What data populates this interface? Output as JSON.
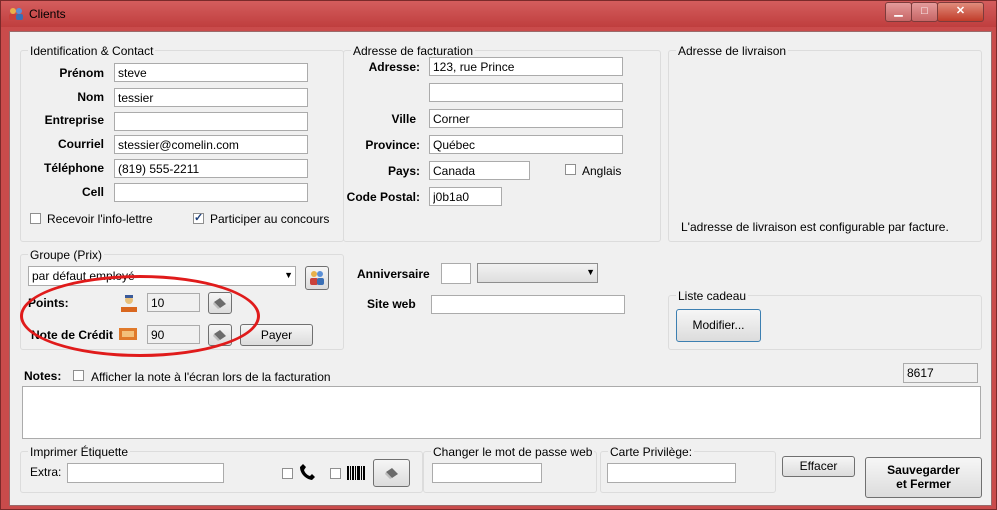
{
  "window": {
    "title": "Clients"
  },
  "identification": {
    "legend": "Identification & Contact",
    "labels": {
      "prenom": "Prénom",
      "nom": "Nom",
      "entreprise": "Entreprise",
      "courriel": "Courriel",
      "telephone": "Téléphone",
      "cell": "Cell"
    },
    "values": {
      "prenom": "steve",
      "nom": "tessier",
      "entreprise": "",
      "courriel": "stessier@comelin.com",
      "telephone": "(819) 555-2211",
      "cell": ""
    },
    "checkboxes": {
      "infolettre": "Recevoir l'info-lettre",
      "concours": "Participer au concours"
    }
  },
  "facturation": {
    "legend": "Adresse de facturation",
    "labels": {
      "adresse": "Adresse:",
      "ville": "Ville",
      "province": "Province:",
      "pays": "Pays:",
      "code_postal": "Code Postal:",
      "anglais": "Anglais"
    },
    "values": {
      "adresse1": "123, rue Prince",
      "adresse2": "",
      "ville": "Corner",
      "province": "Québec",
      "pays": "Canada",
      "code_postal": "j0b1a0"
    }
  },
  "livraison": {
    "legend": "Adresse de livraison",
    "note": "L'adresse de livraison est configurable par facture."
  },
  "groupe": {
    "legend": "Groupe (Prix)",
    "selected": "par défaut  employé",
    "points_label": "Points:",
    "points_value": "10",
    "credit_label": "Note de Crédit",
    "credit_value": "90",
    "payer_label": "Payer"
  },
  "extra": {
    "anniversaire_label": "Anniversaire",
    "site_web_label": "Site web",
    "anniversaire_day": "",
    "site_web_value": ""
  },
  "liste_cadeau": {
    "legend": "Liste cadeau",
    "button": "Modifier..."
  },
  "notes": {
    "label": "Notes:",
    "checkbox_label": "Afficher la note à l'écran lors de la facturation",
    "id_value": "8617",
    "text": ""
  },
  "etiquette": {
    "legend": "Imprimer Étiquette",
    "extra_label": "Extra:",
    "extra_value": ""
  },
  "mot_de_passe": {
    "legend": "Changer le mot de passe web",
    "value": ""
  },
  "carte": {
    "legend": "Carte Privilège:",
    "value": ""
  },
  "buttons": {
    "effacer": "Effacer",
    "sauvegarder_line1": "Sauvegarder",
    "sauvegarder_line2": "et Fermer"
  },
  "colors": {
    "title_bar": "#c94b4b",
    "highlight_ellipse": "#e01b1b",
    "form_bg": "#f0f0f0"
  }
}
